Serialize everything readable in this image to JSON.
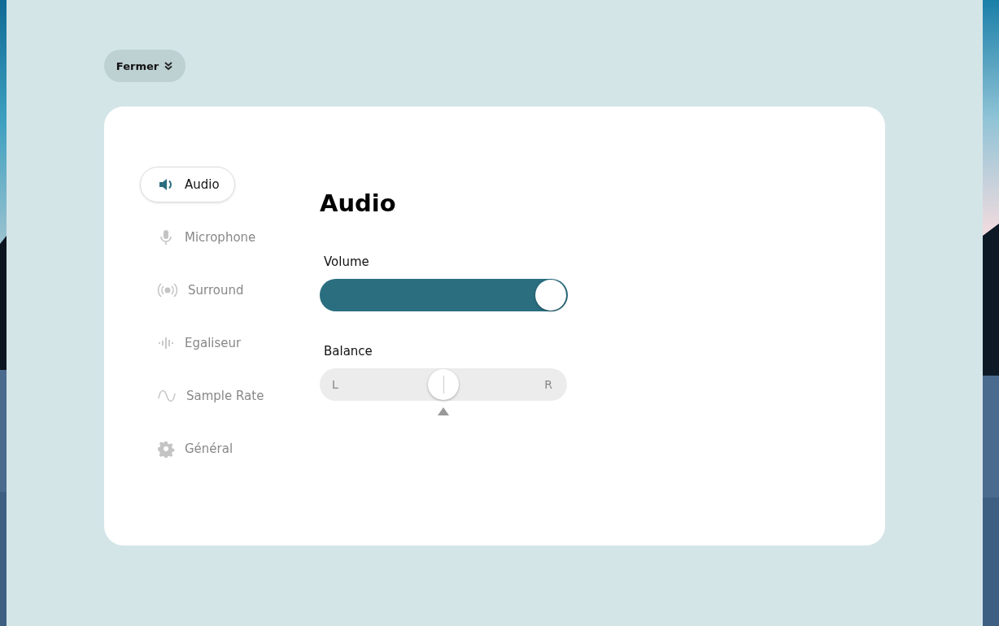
{
  "close_button": {
    "label": "Fermer"
  },
  "nav": [
    {
      "label": "Audio",
      "selected": true
    },
    {
      "label": "Microphone",
      "selected": false
    },
    {
      "label": "Surround",
      "selected": false
    },
    {
      "label": "Egaliseur",
      "selected": false
    },
    {
      "label": "Sample Rate",
      "selected": false
    },
    {
      "label": "Général",
      "selected": false
    }
  ],
  "heading": "Audio",
  "volume": {
    "label": "Volume",
    "level": 1
  },
  "balance": {
    "label": "Balance",
    "left": "L",
    "right": "R",
    "level": 0.5
  }
}
